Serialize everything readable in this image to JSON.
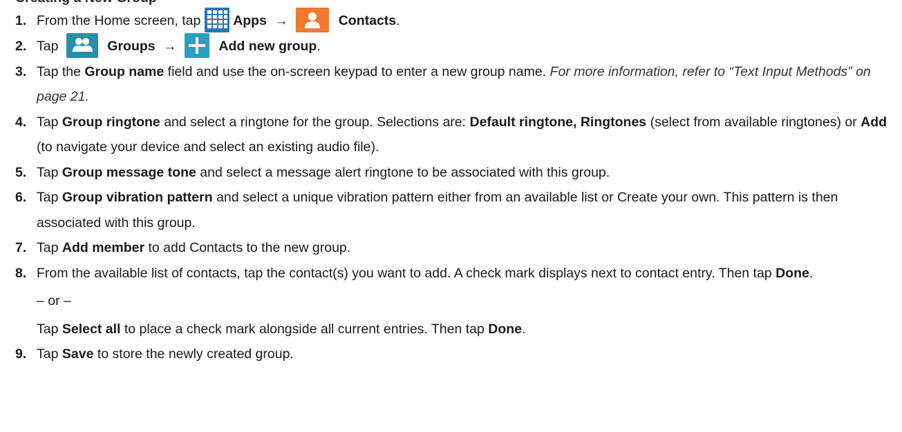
{
  "heading_partial": "Creating a New Group",
  "steps": [
    {
      "num": "1.",
      "p0": "From the Home screen, tap",
      "apps_icon": "apps-grid-icon",
      "apps": "Apps",
      "arrow": "→",
      "contacts_icon": "contacts-person-icon",
      "contacts": "Contacts",
      "end": "."
    },
    {
      "num": "2.",
      "p0": "Tap",
      "groups_icon": "groups-people-icon",
      "groups": "Groups",
      "arrow": "→",
      "add_icon": "add-plus-icon",
      "add": "Add new group",
      "end": "."
    },
    {
      "num": "3.",
      "p0": "Tap the",
      "b0": "Group name",
      "p1": "field and use the on-screen keypad to enter a new group name.",
      "i0": "For more information, refer to “Text Input Methods” on page 21."
    },
    {
      "num": "4.",
      "p0": "Tap",
      "b0": "Group ringtone",
      "p1": "and select a ringtone for the group. Selections are:",
      "b1": "Default ringtone, Ringtones",
      "p2": "(select from available ringtones) or",
      "b2": "Add",
      "p3": "(to navigate your device and select an existing audio file)."
    },
    {
      "num": "5.",
      "p0": "Tap",
      "b0": "Group message tone",
      "p1": "and select a message alert ringtone to be associated with this group."
    },
    {
      "num": "6.",
      "p0": "Tap",
      "b0": "Group vibration pattern",
      "p1": "and select a unique vibration pattern either from an available list or Create your own. This pattern is then associated with this group."
    },
    {
      "num": "7.",
      "p0": "Tap",
      "b0": "Add member",
      "p1": "to add Contacts to the new group."
    },
    {
      "num": "8.",
      "p0": "From the available list of contacts, tap the contact(s) you want to add. A check mark displays next to contact entry. Then tap",
      "b0": "Done",
      "end": ".",
      "or": "– or –",
      "p1": "Tap",
      "b1": "Select all",
      "p2": "to place a check mark alongside all current entries. Then tap",
      "b2": "Done",
      "end2": "."
    },
    {
      "num": "9.",
      "p0": "Tap",
      "b0": "Save",
      "p1": "to store the newly created group."
    }
  ],
  "colors": {
    "apps_icon": "#2a78b8",
    "contacts_icon": "#f07a30",
    "groups_icon": "#2a8fa6",
    "add_icon": "#2aa0c0"
  }
}
